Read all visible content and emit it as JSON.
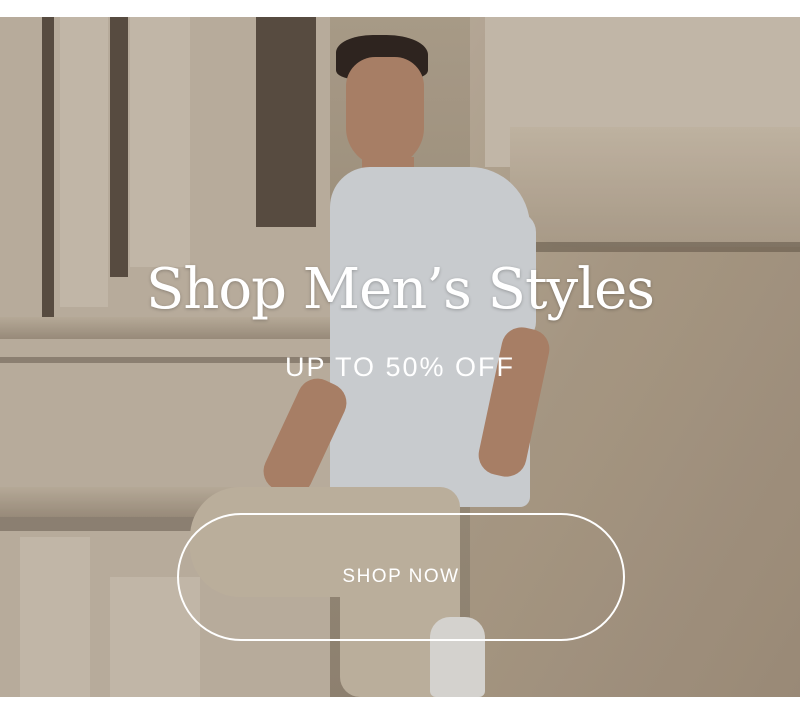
{
  "hero": {
    "headline": "Shop Men’s Styles",
    "subheadline": "UP TO 50% OFF",
    "cta_label": "SHOP NOW",
    "image_alt_icon": "photo-man-leaning-on-stone-wall"
  },
  "colors": {
    "text": "#ffffff",
    "button_border": "#ffffff",
    "page_background": "#ffffff"
  }
}
